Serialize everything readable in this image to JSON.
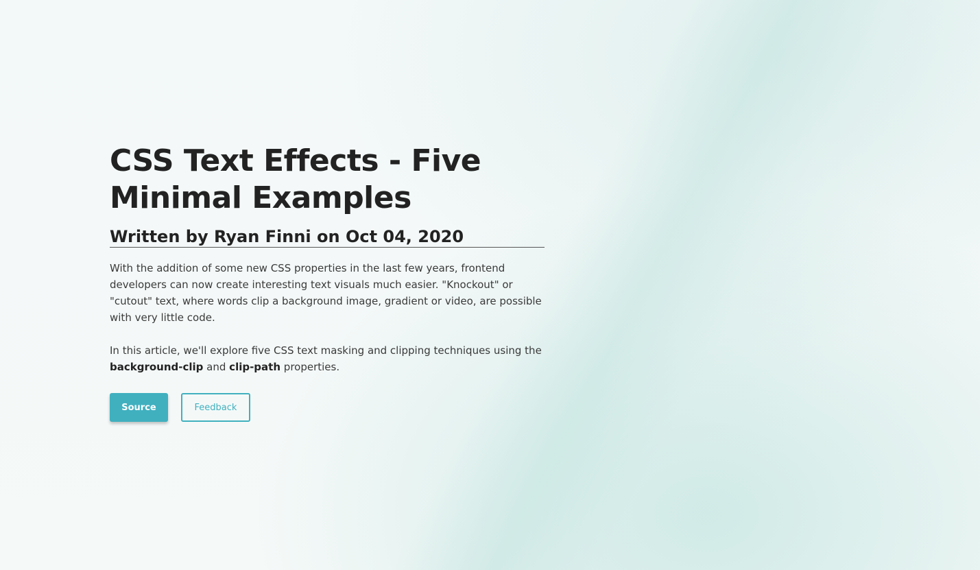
{
  "article": {
    "title": "CSS Text Effects - Five Minimal Examples",
    "byline": "Written by Ryan Finni on Oct 04, 2020",
    "intro": "With the addition of some new CSS properties in the last few years, frontend developers can now create interesting text visuals much easier. \"Knockout\" or \"cutout\" text, where words clip a background image, gradient or video, are possible with very little code.",
    "techniques": {
      "prefix": "In this article, we'll explore five CSS text masking and clipping techniques using the ",
      "property_one": "background-clip",
      "conjunction": " and ",
      "property_two": "clip-path",
      "suffix": " properties."
    }
  },
  "actions": {
    "source_label": "Source",
    "feedback_label": "Feedback"
  },
  "colors": {
    "accent": "#40b0bf",
    "text": "#222222",
    "background": "#f4f9f8"
  }
}
